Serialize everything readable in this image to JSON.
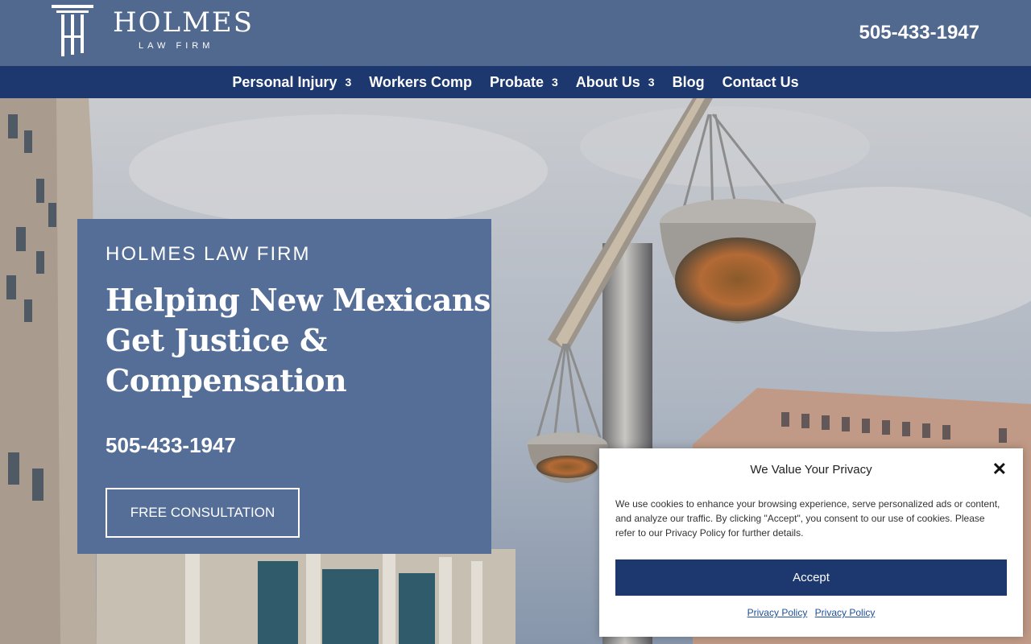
{
  "header": {
    "logo_name": "HOLMES",
    "logo_subtitle": "LAW FIRM",
    "phone": "505-433-1947"
  },
  "nav": {
    "items": [
      {
        "label": "Personal Injury",
        "has_dropdown": true
      },
      {
        "label": "Workers Comp",
        "has_dropdown": false
      },
      {
        "label": "Probate",
        "has_dropdown": true
      },
      {
        "label": "About Us",
        "has_dropdown": true
      },
      {
        "label": "Blog",
        "has_dropdown": false
      },
      {
        "label": "Contact Us",
        "has_dropdown": false
      }
    ],
    "dropdown_glyph": "3"
  },
  "hero": {
    "eyebrow": "HOLMES LAW FIRM",
    "headline_lines": [
      "Helping New Mexicans",
      "Get Justice &",
      "Compensation"
    ],
    "phone": "505-433-1947",
    "cta_label": "FREE CONSULTATION"
  },
  "cookie": {
    "title": "We Value Your Privacy",
    "text": "We use cookies to enhance your browsing experience, serve personalized ads or content, and analyze our traffic. By clicking \"Accept\", you consent to our use of cookies. Please refer to our Privacy Policy for further details.",
    "accept_label": "Accept",
    "links": [
      "Privacy Policy",
      "Privacy Policy"
    ]
  },
  "colors": {
    "header_bg": "#51688f",
    "nav_bg": "#1c386f",
    "card_bg": "#546e97",
    "accent": "#1c386f"
  }
}
